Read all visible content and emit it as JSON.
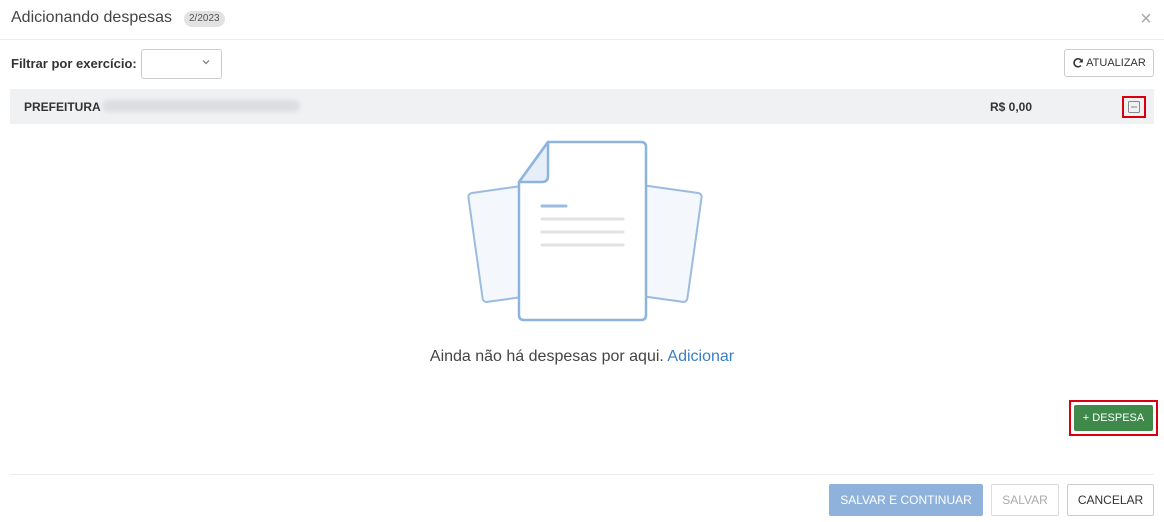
{
  "header": {
    "title": "Adicionando despesas",
    "badge": "2/2023",
    "close_icon": "close-icon"
  },
  "filter": {
    "label": "Filtrar por exercício:",
    "selected_value": "",
    "chevron_icon": "chevron-down-icon"
  },
  "toolbar": {
    "refresh_label": "ATUALIZAR",
    "refresh_icon": "refresh-icon"
  },
  "org_row": {
    "label": "PREFEITURA",
    "value": "R$ 0,00",
    "collapse_icon": "minus-square-icon"
  },
  "empty_state": {
    "message": "Ainda não há despesas por aqui.",
    "link": "Adicionar",
    "illustration_icon": "documents-icon"
  },
  "actions": {
    "add_expense_label": "+ DESPESA",
    "save_continue_label": "SALVAR E CONTINUAR",
    "save_label": "SALVAR",
    "cancel_label": "CANCELAR"
  },
  "colors": {
    "primary_disabled": "#8fb2dd",
    "success": "#3f8a4a",
    "highlight": "#d8000c",
    "link": "#3a7fc4"
  }
}
